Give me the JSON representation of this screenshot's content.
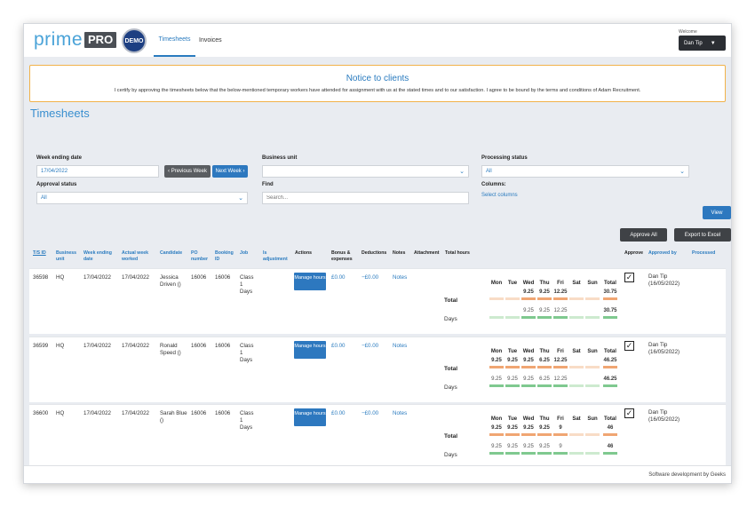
{
  "header": {
    "logo_prime": "prime",
    "logo_pro": "PRO",
    "demo_badge": "DEMO",
    "tabs": [
      "Timesheets",
      "Invoices"
    ],
    "welcome": "Welcome",
    "user": "Dan Tip"
  },
  "notice": {
    "title": "Notice to clients",
    "body": "I certify by approving the timesheets below that the below-mentioned temporary workers have attended for assignment with us at the stated times and to our satisfaction. I agree to be bound by the terms and conditions of Adam Recruitment."
  },
  "page_title": "Timesheets",
  "filters": {
    "week_ending_label": "Week ending date",
    "week_ending_value": "17/04/2022",
    "prev_week": "Previous Week",
    "next_week": "Next Week",
    "business_unit_label": "Business unit",
    "business_unit_value": "",
    "processing_status_label": "Processing status",
    "processing_status_value": "All",
    "approval_status_label": "Approval status",
    "approval_status_value": "All",
    "find_label": "Find",
    "find_placeholder": "Search...",
    "columns_label": "Columns:",
    "select_columns": "Select columns",
    "view_button": "View",
    "approve_all": "Approve All",
    "export_excel": "Export to Excel"
  },
  "table": {
    "headers": [
      "T/S ID",
      "Business unit",
      "Week ending date",
      "Actual week worked",
      "Candidate",
      "PO number",
      "Booking ID",
      "Job",
      "Is adjustment",
      "Actions",
      "Bonus & expenses",
      "Deductions",
      "Notes",
      "Attachment",
      "Total hours",
      "Approve",
      "Approved by",
      "Processed"
    ],
    "day_headers": [
      "Mon",
      "Tue",
      "Wed",
      "Thu",
      "Fri",
      "Sat",
      "Sun",
      "Total"
    ],
    "total_label": "Total",
    "days_label": "Days",
    "manage_label": "Manage hours",
    "rows": [
      {
        "id": "36598",
        "unit": "HQ",
        "week_ending": "17/04/2022",
        "actual_week": "17/04/2022",
        "candidate": "Jessica Driven ()",
        "po": "16006",
        "booking": "16006",
        "job": "Class 1 Days",
        "bonus": "£0.00",
        "deductions": "−£0.00",
        "notes": "Notes",
        "total_hours": [
          "",
          "",
          "9.25",
          "9.25",
          "12.25",
          "",
          "",
          "30.75"
        ],
        "days": [
          "",
          "",
          "9.25",
          "9.25",
          "12.25",
          "",
          "",
          "30.75"
        ],
        "approved_by": "Dan Tip",
        "approved_date": "(16/05/2022)",
        "approved": true
      },
      {
        "id": "36599",
        "unit": "HQ",
        "week_ending": "17/04/2022",
        "actual_week": "17/04/2022",
        "candidate": "Ronald Speed ()",
        "po": "16006",
        "booking": "16006",
        "job": "Class 1 Days",
        "bonus": "£0.00",
        "deductions": "−£0.00",
        "notes": "Notes",
        "total_hours": [
          "9.25",
          "9.25",
          "9.25",
          "6.25",
          "12.25",
          "",
          "",
          "46.25"
        ],
        "days": [
          "9.25",
          "9.25",
          "9.25",
          "6.25",
          "12.25",
          "",
          "",
          "46.25"
        ],
        "approved_by": "Dan Tip",
        "approved_date": "(16/05/2022)",
        "approved": true
      },
      {
        "id": "36600",
        "unit": "HQ",
        "week_ending": "17/04/2022",
        "actual_week": "17/04/2022",
        "candidate": "Sarah Blue ()",
        "po": "16006",
        "booking": "16006",
        "job": "Class 1 Days",
        "bonus": "£0.00",
        "deductions": "−£0.00",
        "notes": "Notes",
        "total_hours": [
          "9.25",
          "9.25",
          "9.25",
          "9.25",
          "9",
          "",
          "",
          "46"
        ],
        "days": [
          "9.25",
          "9.25",
          "9.25",
          "9.25",
          "9",
          "",
          "",
          "46"
        ],
        "approved_by": "Dan Tip",
        "approved_date": "(16/05/2022)",
        "approved": true
      }
    ]
  },
  "colors": {
    "accent": "#2a7bbf",
    "notice_border": "#f1b24a",
    "bar_hours_on": "#f0a673",
    "bar_hours_off": "#f8dcc6",
    "bar_days_on": "#7fc98f",
    "bar_days_off": "#cdeacf"
  },
  "footer": "Software development by Geeks"
}
